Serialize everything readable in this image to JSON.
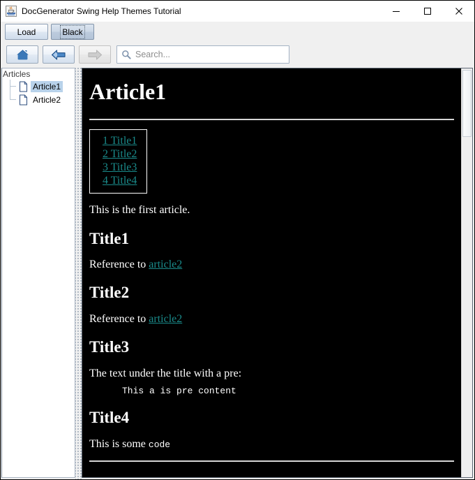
{
  "window": {
    "title": "DocGenerator Swing Help Themes Tutorial",
    "app_icon": "java-coffee-cup-icon",
    "controls": {
      "minimize": "minimize-icon",
      "maximize": "maximize-icon",
      "close": "close-icon"
    }
  },
  "theme_bar": {
    "buttons": [
      {
        "label": "Load",
        "name": "load-button",
        "selected": false
      },
      {
        "label": "Black",
        "name": "theme-black-button",
        "selected": true
      }
    ]
  },
  "nav_bar": {
    "home": {
      "icon": "home-icon",
      "enabled": true
    },
    "back": {
      "icon": "arrow-left-icon",
      "enabled": true
    },
    "forward": {
      "icon": "arrow-right-icon",
      "enabled": false
    },
    "search": {
      "icon": "search-icon",
      "value": "",
      "placeholder": "Search..."
    }
  },
  "sidebar": {
    "root_label": "Articles",
    "items": [
      {
        "label": "Article1",
        "icon": "document-icon",
        "selected": true
      },
      {
        "label": "Article2",
        "icon": "document-icon",
        "selected": false
      }
    ]
  },
  "content": {
    "title": "Article1",
    "toc": [
      {
        "number": "1",
        "label": "Title1"
      },
      {
        "number": "2",
        "label": "Title2"
      },
      {
        "number": "3",
        "label": "Title3"
      },
      {
        "number": "4",
        "label": "Title4"
      }
    ],
    "intro": "This is the first article.",
    "sections": [
      {
        "heading": "Title1",
        "para_prefix": "Reference to ",
        "link_text": "article2"
      },
      {
        "heading": "Title2",
        "para_prefix": "Reference to ",
        "link_text": "article2"
      },
      {
        "heading": "Title3",
        "para_prefix": "The text under the title with a pre:",
        "pre_text": "This a is pre content"
      },
      {
        "heading": "Title4",
        "para_prefix": "This is some ",
        "code_text": "code"
      }
    ]
  },
  "colors": {
    "background": "#000000",
    "text": "#ffffff",
    "link": "#1a8a8a",
    "chrome": "#f0f0f0",
    "selection": "#b8d2ea"
  }
}
